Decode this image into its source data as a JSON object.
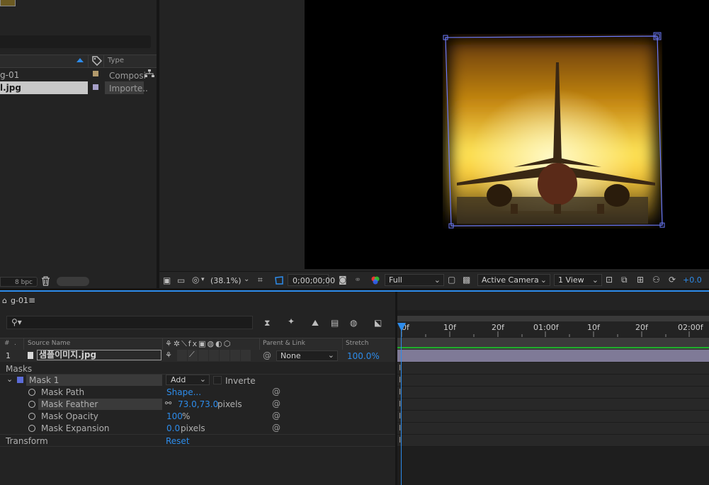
{
  "project": {
    "type_header": "Type",
    "items": [
      {
        "name": "g-01",
        "type": "Composi",
        "swatch": "#b29a6c"
      },
      {
        "name": "l.jpg",
        "type": "Importe..",
        "swatch": "#a6a0c8"
      }
    ],
    "bpc": "8 bpc"
  },
  "viewer": {
    "zoom": "(38.1%)",
    "timecode": "0;00;00;00",
    "resolution": "Full",
    "camera": "Active Camera",
    "views": "1 View",
    "exposure": "+0.0"
  },
  "timeline": {
    "comp_tab": "g-01",
    "columns": {
      "num": "#",
      "source_name": "Source Name",
      "parent_link": "Parent & Link",
      "stretch": "Stretch"
    },
    "layer": {
      "index": "1",
      "name": "샘플이미지.jpg",
      "parent": "None",
      "stretch": "100.0%"
    },
    "masks_label": "Masks",
    "mask": {
      "name": "Mask 1",
      "mode": "Add",
      "inverted_label": "Inverte"
    },
    "properties": [
      {
        "label": "Mask Path",
        "value": "Shape...",
        "unit": ""
      },
      {
        "label": "Mask Feather",
        "value": "73.0,73.0",
        "unit": "pixels"
      },
      {
        "label": "Mask Opacity",
        "value": "100",
        "unit": "%"
      },
      {
        "label": "Mask Expansion",
        "value": "0.0",
        "unit": "pixels"
      }
    ],
    "transform_label": "Transform",
    "transform_value": "Reset",
    "ruler": [
      "0f",
      "10f",
      "20f",
      "01:00f",
      "10f",
      "20f",
      "02:00f"
    ]
  }
}
